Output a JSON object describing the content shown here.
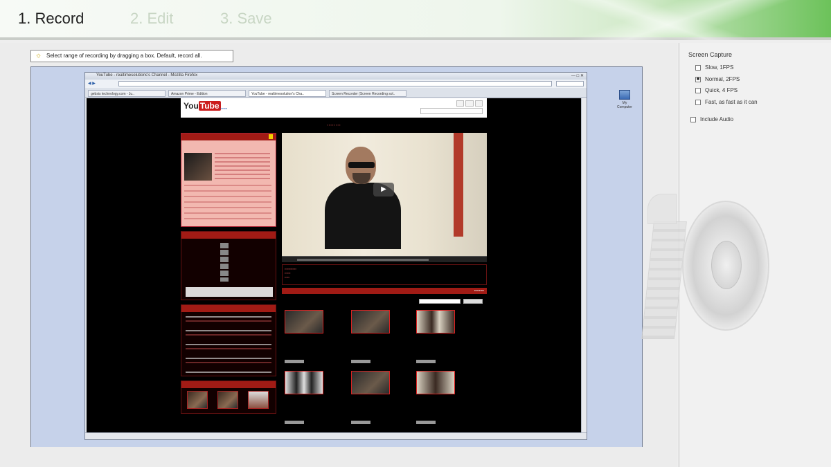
{
  "steps": [
    {
      "label": "1. Record",
      "active": true
    },
    {
      "label": "2. Edit",
      "active": false
    },
    {
      "label": "3. Save",
      "active": false
    }
  ],
  "capture": {
    "hint": "Select range of recording by dragging a box. Default, record all."
  },
  "desktop_icon": {
    "label": "My Computer"
  },
  "browser": {
    "title": "YouTube - realtimesolutions's Channel - Mozilla Firefox",
    "tabs": [
      "gebsis technology.com - Ju..",
      "Amazon Prime - Edition",
      "YouTube - realtimesolution's Cha..",
      "Screen Recorder (Screen Recording sol.."
    ]
  },
  "screen_capture": {
    "title": "Screen Capture",
    "options": [
      {
        "label": "Slow, 1FPS",
        "checked": false
      },
      {
        "label": "Normal, 2FPS",
        "checked": true
      },
      {
        "label": "Quick, 4 FPS",
        "checked": false
      },
      {
        "label": "Fast, as fast as it can",
        "checked": false
      }
    ],
    "include_audio": {
      "label": "Include Audio",
      "checked": false
    }
  },
  "icons": {
    "hint": "lightbulb-icon",
    "reel": "film-reel-icon",
    "play": "play-icon"
  },
  "colors": {
    "accent_green": "#6cc25a",
    "youtube_red": "#a11b15"
  }
}
